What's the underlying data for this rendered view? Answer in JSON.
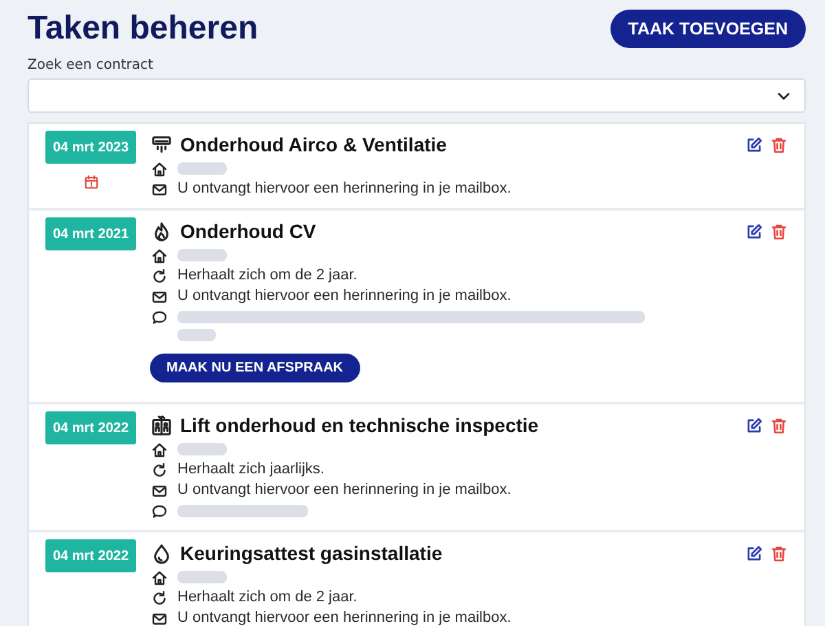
{
  "page": {
    "title": "Taken beheren",
    "add_button": "TAAK TOEVOEGEN"
  },
  "search": {
    "label": "Zoek een contract"
  },
  "tasks": [
    {
      "date": "04 mrt 2023",
      "calendar_mark": true,
      "kind": "airco",
      "title": "Onderhoud Airco & Ventilatie",
      "lines": [
        {
          "kind": "address"
        },
        {
          "kind": "mail",
          "text": "U ontvangt hiervoor een herinnering in je mailbox."
        }
      ]
    },
    {
      "date": "04 mrt 2021",
      "calendar_mark": false,
      "kind": "flame",
      "title": "Onderhoud CV",
      "lines": [
        {
          "kind": "address"
        },
        {
          "kind": "repeat",
          "text": "Herhaalt zich om de 2 jaar."
        },
        {
          "kind": "mail",
          "text": "U ontvangt hiervoor een herinnering in je mailbox."
        },
        {
          "kind": "note-long"
        }
      ],
      "button": "MAAK NU EEN AFSPRAAK"
    },
    {
      "date": "04 mrt 2022",
      "calendar_mark": false,
      "kind": "lift",
      "title": "Lift onderhoud en technische inspectie",
      "lines": [
        {
          "kind": "address"
        },
        {
          "kind": "repeat",
          "text": "Herhaalt zich jaarlijks."
        },
        {
          "kind": "mail",
          "text": "U ontvangt hiervoor een herinnering in je mailbox."
        },
        {
          "kind": "note-short"
        }
      ]
    },
    {
      "date": "04 mrt 2022",
      "calendar_mark": false,
      "kind": "drop",
      "title": "Keuringsattest gasinstallatie",
      "lines": [
        {
          "kind": "address"
        },
        {
          "kind": "repeat",
          "text": "Herhaalt zich om de 2 jaar."
        },
        {
          "kind": "mail",
          "text": "U ontvangt hiervoor een herinnering in je mailbox."
        }
      ]
    }
  ]
}
